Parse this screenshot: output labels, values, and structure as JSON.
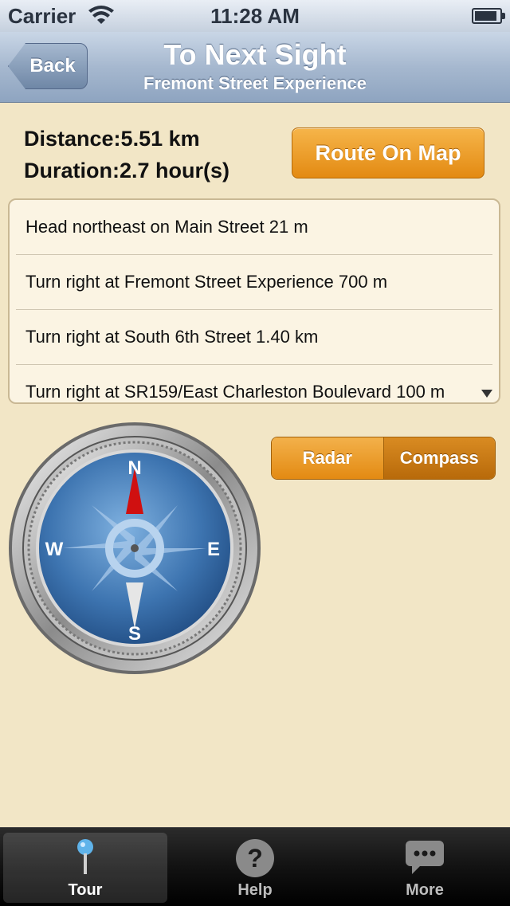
{
  "status": {
    "carrier": "Carrier",
    "time": "11:28 AM"
  },
  "nav": {
    "back_label": "Back",
    "title": "To Next Sight",
    "subtitle": "Fremont Street Experience"
  },
  "info": {
    "distance_label": "Distance:",
    "distance_value": "5.51 km",
    "duration_label": "Duration:",
    "duration_value": "2.7 hour(s)",
    "route_button": "Route On Map"
  },
  "directions": [
    "Head northeast on Main Street 21 m",
    "Turn right at Fremont Street Experience 700 m",
    "Turn right at South 6th Street 1.40 km",
    "Turn right at SR159/East Charleston Boulevard 100 m"
  ],
  "segments": {
    "left": "Radar",
    "right": "Compass",
    "selected": "Compass"
  },
  "compass": {
    "north": "N",
    "south": "S",
    "east": "E",
    "west": "W"
  },
  "tabs": [
    {
      "label": "Tour",
      "icon": "pin-icon",
      "active": true
    },
    {
      "label": "Help",
      "icon": "question-icon",
      "active": false
    },
    {
      "label": "More",
      "icon": "chat-bubble-icon",
      "active": false
    }
  ]
}
